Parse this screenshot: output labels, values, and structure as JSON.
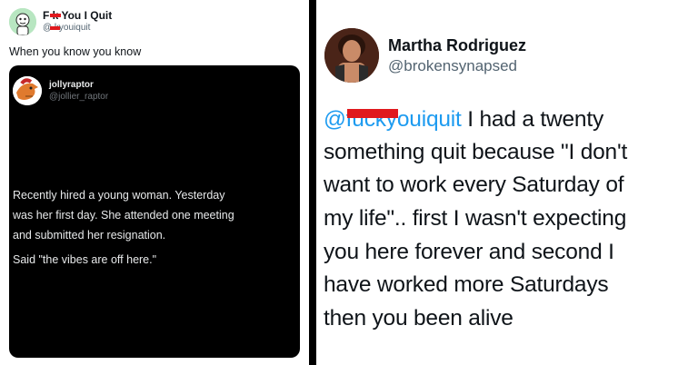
{
  "left_tweet": {
    "author_name": "F k You I Quit",
    "author_handle": "@ kyouiquit",
    "text": "When you know you know",
    "embedded": {
      "author_name": "jollyraptor",
      "author_handle": "@jollier_raptor",
      "lines": [
        "Recently hired a young woman. Yesterday",
        "was her first day. She attended one meeting",
        "and submitted her resignation.",
        "Said \"the vibes are off here.\""
      ]
    }
  },
  "right_tweet": {
    "author_name": "Martha Rodriguez",
    "author_handle": "@brokensynapsed",
    "mention": "@fuckyouiquit",
    "first_line_rest": " I had a twenty",
    "lines": [
      "something quit because \"I don't",
      "want to work every Saturday of",
      "my life\".. first I wasn't expecting",
      "you here forever and second I",
      "have worked more Saturdays",
      "then you been alive"
    ]
  },
  "colors": {
    "accent": "#1d9bf0",
    "redaction": "#e0191e",
    "divider": "#000000"
  }
}
